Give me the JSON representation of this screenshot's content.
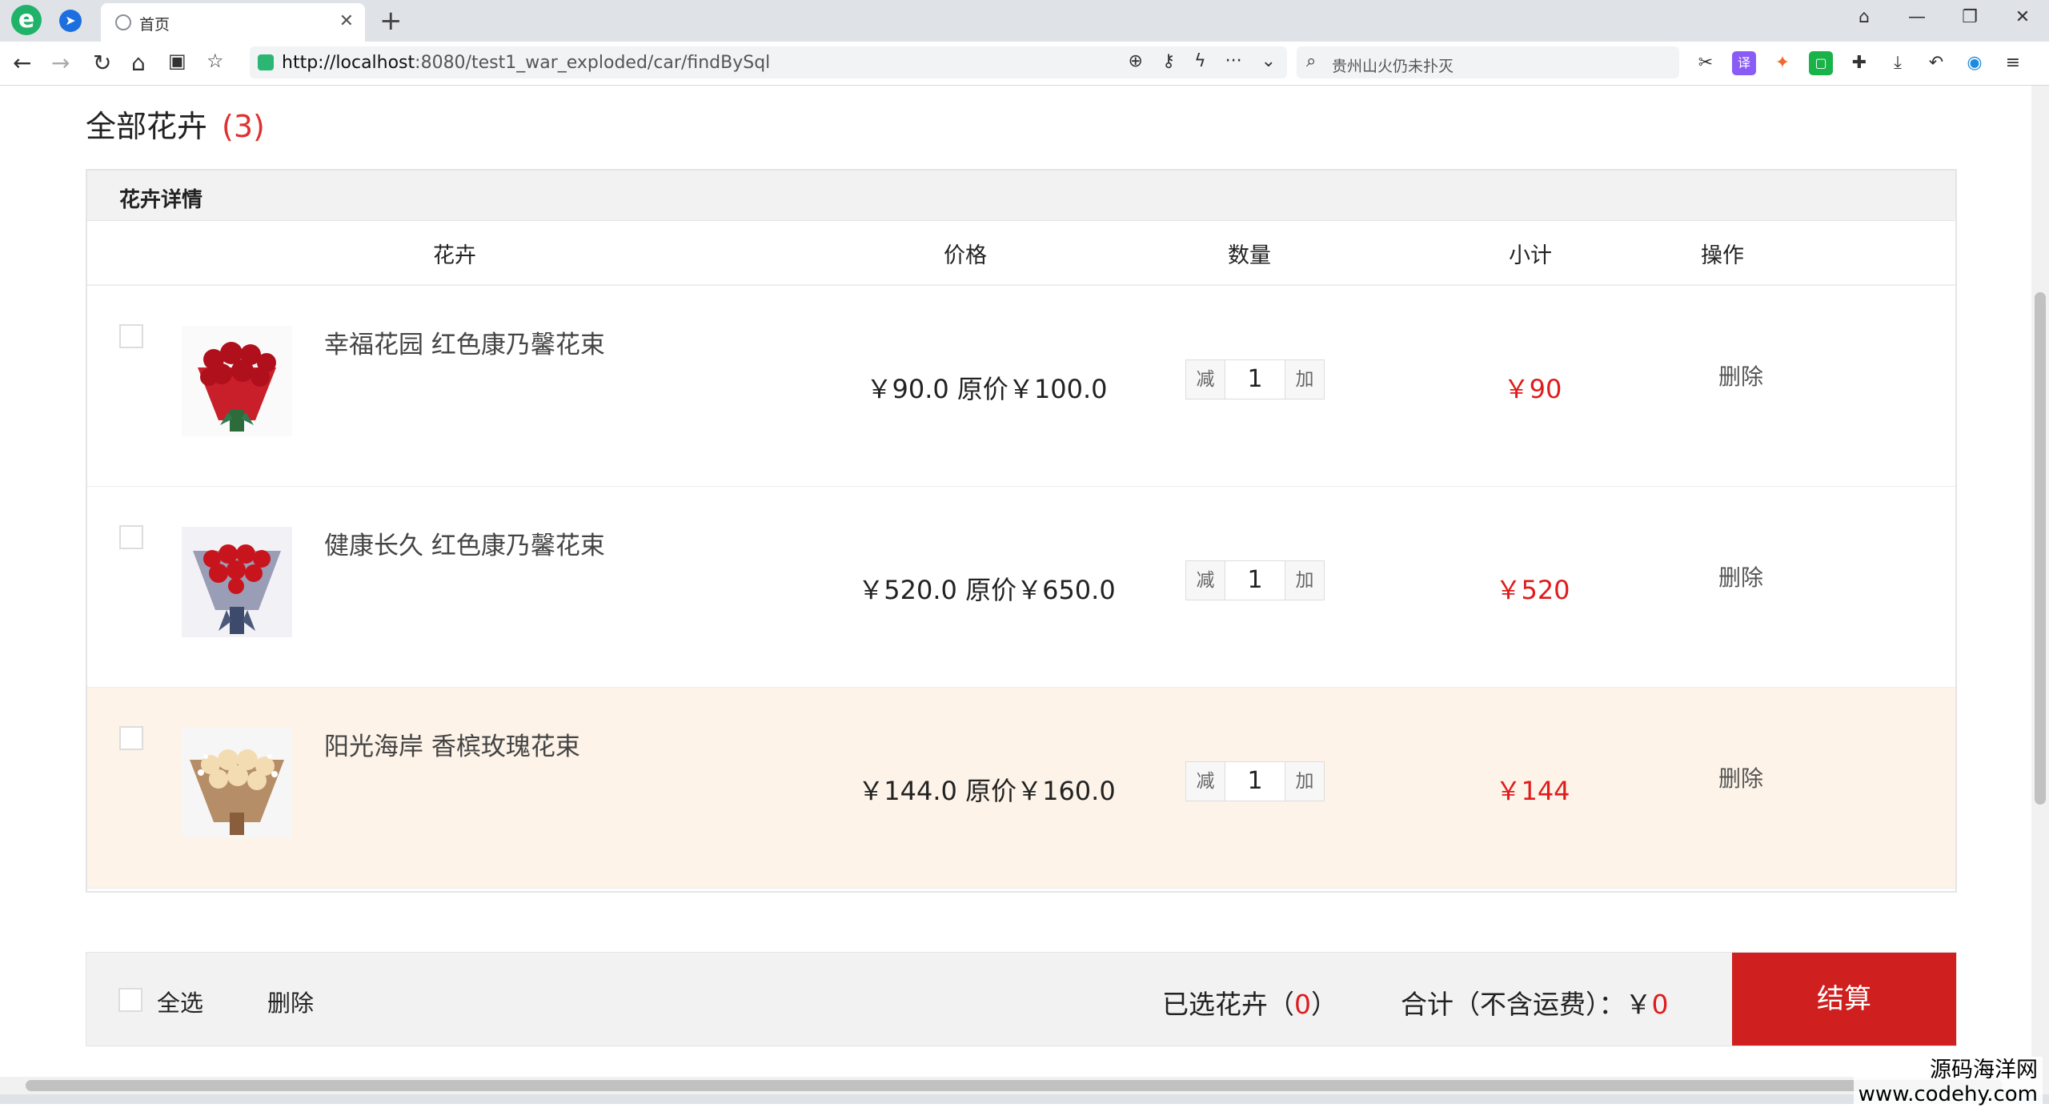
{
  "browser": {
    "tab_title": "首页",
    "url_host": "http://localhost",
    "url_rest": ":8080/test1_war_exploded/car/findBySql",
    "search_text": "贵州山火仍未扑灭"
  },
  "page": {
    "heading": "全部花卉",
    "count": "(3)",
    "detail_title": "花卉详情",
    "columns": {
      "flower": "花卉",
      "price": "价格",
      "quantity": "数量",
      "subtotal": "小计",
      "action": "操作"
    },
    "items": [
      {
        "name": "幸福花园 红色康乃馨花束",
        "price": "￥90.0 原价￥100.0",
        "minus": "减",
        "qty": "1",
        "plus": "加",
        "subtotal": "￥90",
        "delete": "删除"
      },
      {
        "name": "健康长久 红色康乃馨花束",
        "price": "￥520.0 原价￥650.0",
        "minus": "减",
        "qty": "1",
        "plus": "加",
        "subtotal": "￥520",
        "delete": "删除"
      },
      {
        "name": "阳光海岸 香槟玫瑰花束",
        "price": "￥144.0 原价￥160.0",
        "minus": "减",
        "qty": "1",
        "plus": "加",
        "subtotal": "￥144",
        "delete": "删除"
      }
    ],
    "footer": {
      "select_all": "全选",
      "delete": "删除",
      "selected_prefix": "已选花卉（",
      "selected_count": "0",
      "selected_suffix": "）",
      "total_label": "合计（不含运费）：￥",
      "total_value": "0",
      "checkout": "结算"
    }
  },
  "watermark": {
    "line1": "源码海洋网",
    "line2": "www.codehy.com"
  },
  "colors": {
    "accent_red": "#d01f1f",
    "price_red": "#e01b1b",
    "highlight_row": "#fdf3e8"
  }
}
